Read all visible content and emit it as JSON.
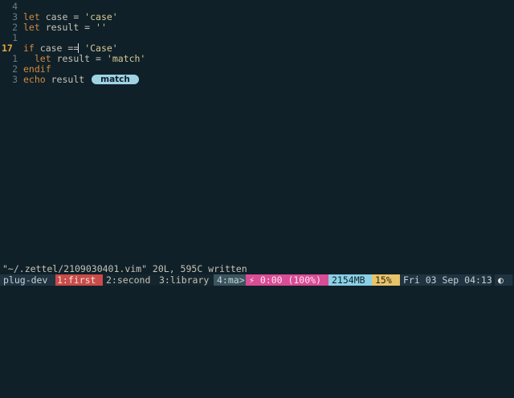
{
  "editor": {
    "lines": [
      {
        "num": "4",
        "current": false,
        "tokens": []
      },
      {
        "num": "3",
        "current": false,
        "tokens": [
          {
            "cls": "kw",
            "t": "let"
          },
          {
            "cls": "plain",
            "t": " case = "
          },
          {
            "cls": "str",
            "t": "'case'"
          }
        ]
      },
      {
        "num": "2",
        "current": false,
        "tokens": [
          {
            "cls": "kw",
            "t": "let"
          },
          {
            "cls": "plain",
            "t": " result = "
          },
          {
            "cls": "str",
            "t": "''"
          }
        ]
      },
      {
        "num": "1",
        "current": false,
        "tokens": []
      },
      {
        "num": "17",
        "current": true,
        "tokens": [
          {
            "cls": "kw",
            "t": "if"
          },
          {
            "cls": "plain",
            "t": " case =="
          },
          {
            "cls": "cursor",
            "t": ""
          },
          {
            "cls": "plain",
            "t": " "
          },
          {
            "cls": "str",
            "t": "'Case'"
          }
        ]
      },
      {
        "num": "1",
        "current": false,
        "tokens": [
          {
            "cls": "plain",
            "t": "  "
          },
          {
            "cls": "kw",
            "t": "let"
          },
          {
            "cls": "plain",
            "t": " result = "
          },
          {
            "cls": "str",
            "t": "'match'"
          }
        ]
      },
      {
        "num": "2",
        "current": false,
        "tokens": [
          {
            "cls": "kw",
            "t": "endif"
          }
        ]
      },
      {
        "num": "3",
        "current": false,
        "tokens": [
          {
            "cls": "kw",
            "t": "echo"
          },
          {
            "cls": "plain",
            "t": " result"
          }
        ]
      }
    ],
    "virtual_text": "match"
  },
  "cmdline": "\"~/.zettel/2109030401.vim\" 20L, 595C written",
  "statusbar": {
    "session": "plug-dev",
    "windows": [
      "1:first",
      "2:second",
      "3:library",
      "4:ma>"
    ],
    "battery": "⚡ 0:00 (100%)",
    "memory": "2154MB",
    "cpu": "15%",
    "datetime": "Fri 03 Sep 04:13",
    "moon": "◐"
  },
  "colors": {
    "background": "#0f2029",
    "keyword": "#d4883c",
    "string": "#d9c894",
    "active_window": "#c94b4b",
    "battery_segment": "#d94c96",
    "memory_segment": "#8ad0e6",
    "cpu_segment": "#e7c36a"
  }
}
